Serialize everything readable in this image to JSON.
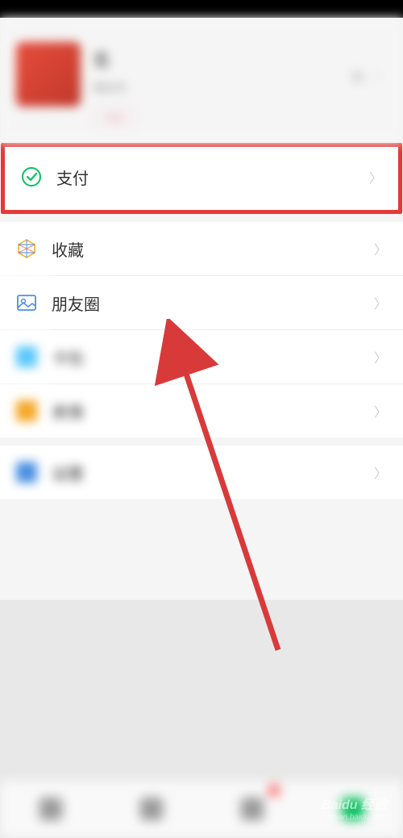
{
  "profile": {
    "name": "名",
    "id_label": "微信号",
    "badge": "状态"
  },
  "menu": {
    "pay": {
      "label": "支付"
    },
    "favorites": {
      "label": "收藏"
    },
    "moments": {
      "label": "朋友圈"
    },
    "item4": {
      "label": "卡包"
    },
    "item5": {
      "label": "表情"
    },
    "item6": {
      "label": "设置"
    }
  },
  "watermark": {
    "brand": "Baidu 经验",
    "url": "jingyan.baidu.com"
  },
  "colors": {
    "highlight": "#e53935",
    "wechat_green": "#07c160",
    "arrow": "#d83a3a"
  }
}
